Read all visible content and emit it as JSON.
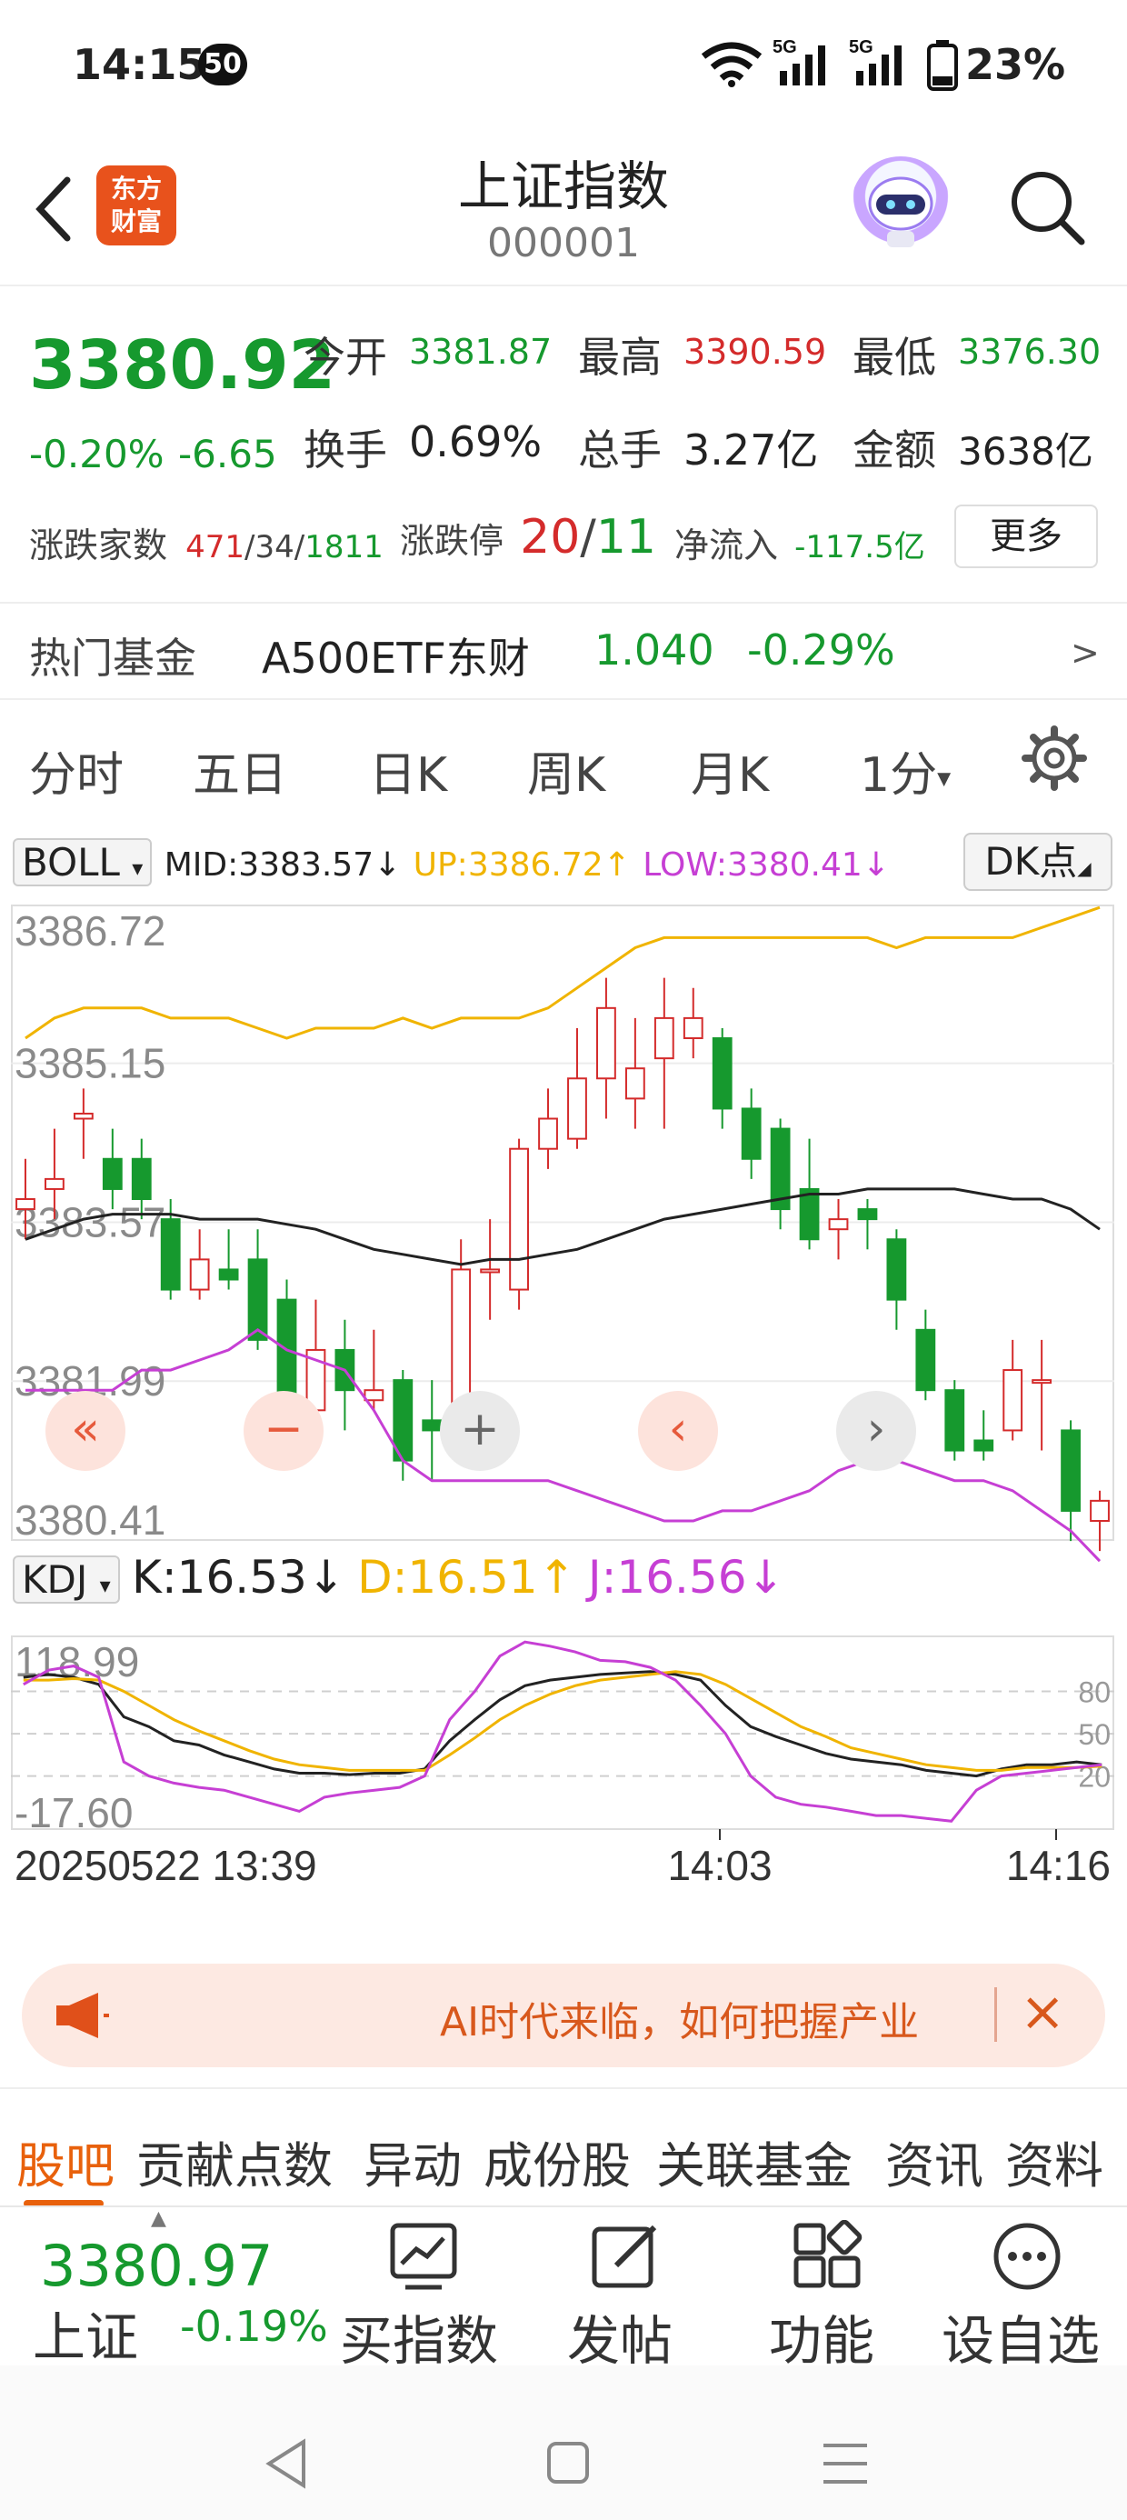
{
  "status_bar": {
    "time": "14:15",
    "badge": "50",
    "network1": "5G",
    "network2": "5G",
    "battery": "23%"
  },
  "header": {
    "title": "上证指数",
    "code": "000001",
    "logo_line1": "东方",
    "logo_line2": "财富"
  },
  "quote": {
    "price": "3380.92",
    "change_pct": "-0.20%",
    "change_abs": "-6.65",
    "open_label": "今开",
    "open": "3381.87",
    "high_label": "最高",
    "high": "3390.59",
    "low_label": "最低",
    "low": "3376.30",
    "turnover_label": "换手",
    "turnover": "0.69%",
    "volume_label": "总手",
    "volume": "3.27亿",
    "amount_label": "金额",
    "amount": "3638亿",
    "breadth_label": "涨跌家数",
    "breadth_up": "471",
    "breadth_flat": "34",
    "breadth_down": "1811",
    "limit_label": "涨跌停",
    "limit_up": "20",
    "limit_down": "11",
    "netflow_label": "净流入",
    "netflow": "-117.5亿",
    "more_label": "更多",
    "sep": "/"
  },
  "hot_fund": {
    "label": "热门基金",
    "name": "A500ETF东财",
    "price": "1.040",
    "change": "-0.29%",
    "arrow": ">"
  },
  "tabs": {
    "items": [
      "分时",
      "五日",
      "日K",
      "周K",
      "月K"
    ],
    "active": "1分",
    "active_arrow": "▾"
  },
  "indicator_boll": {
    "name": "BOLL",
    "mid": "MID:3383.57↓",
    "up": "UP:3386.72↑",
    "low": "LOW:3380.41↓",
    "dk_label": "DK点"
  },
  "indicator_kdj": {
    "name": "KDJ",
    "k": "K:16.53↓",
    "d": "D:16.51↑",
    "j": "J:16.56↓"
  },
  "chart_data": [
    {
      "type": "candlestick",
      "indicator": "BOLL",
      "ylim": [
        3380.41,
        3386.72
      ],
      "y_ticks": [
        "3386.72",
        "3385.15",
        "3383.57",
        "3381.99",
        "3380.41"
      ],
      "x_labels": [
        "20250522 13:39",
        "14:03",
        "14:16"
      ],
      "colors": {
        "up": "#d42b2b",
        "down": "#16992e",
        "mid": "#222222",
        "upper": "#f0b400",
        "lower": "#c63fd4"
      },
      "candles": [
        {
          "o": 3383.7,
          "c": 3383.8,
          "h": 3384.2,
          "l": 3383.4
        },
        {
          "o": 3383.9,
          "c": 3384.0,
          "h": 3384.5,
          "l": 3383.6
        },
        {
          "o": 3384.6,
          "c": 3384.65,
          "h": 3384.9,
          "l": 3384.2
        },
        {
          "o": 3384.2,
          "c": 3383.9,
          "h": 3384.5,
          "l": 3383.7
        },
        {
          "o": 3384.2,
          "c": 3383.8,
          "h": 3384.4,
          "l": 3383.6
        },
        {
          "o": 3383.6,
          "c": 3382.9,
          "h": 3383.8,
          "l": 3382.8
        },
        {
          "o": 3382.9,
          "c": 3383.2,
          "h": 3383.5,
          "l": 3382.8
        },
        {
          "o": 3383.1,
          "c": 3383.0,
          "h": 3383.5,
          "l": 3382.9
        },
        {
          "o": 3383.2,
          "c": 3382.4,
          "h": 3383.5,
          "l": 3382.3
        },
        {
          "o": 3382.8,
          "c": 3381.7,
          "h": 3383.0,
          "l": 3381.5
        },
        {
          "o": 3381.7,
          "c": 3382.3,
          "h": 3382.8,
          "l": 3381.6
        },
        {
          "o": 3382.3,
          "c": 3381.9,
          "h": 3382.6,
          "l": 3381.5
        },
        {
          "o": 3381.8,
          "c": 3381.9,
          "h": 3382.5,
          "l": 3381.7
        },
        {
          "o": 3382.0,
          "c": 3381.2,
          "h": 3382.1,
          "l": 3381.0
        },
        {
          "o": 3381.6,
          "c": 3381.5,
          "h": 3382.0,
          "l": 3381.0
        },
        {
          "o": 3381.6,
          "c": 3383.1,
          "h": 3383.4,
          "l": 3381.5
        },
        {
          "o": 3383.1,
          "c": 3383.1,
          "h": 3383.6,
          "l": 3382.6
        },
        {
          "o": 3382.9,
          "c": 3384.3,
          "h": 3384.4,
          "l": 3382.7
        },
        {
          "o": 3384.3,
          "c": 3384.6,
          "h": 3384.9,
          "l": 3384.1
        },
        {
          "o": 3384.4,
          "c": 3385.0,
          "h": 3385.5,
          "l": 3384.3
        },
        {
          "o": 3385.0,
          "c": 3385.7,
          "h": 3386.0,
          "l": 3384.6
        },
        {
          "o": 3384.8,
          "c": 3385.1,
          "h": 3385.6,
          "l": 3384.5
        },
        {
          "o": 3385.2,
          "c": 3385.6,
          "h": 3386.0,
          "l": 3384.5
        },
        {
          "o": 3385.4,
          "c": 3385.6,
          "h": 3385.9,
          "l": 3385.2
        },
        {
          "o": 3385.4,
          "c": 3384.7,
          "h": 3385.5,
          "l": 3384.5
        },
        {
          "o": 3384.7,
          "c": 3384.2,
          "h": 3384.9,
          "l": 3384.0
        },
        {
          "o": 3384.5,
          "c": 3383.7,
          "h": 3384.6,
          "l": 3383.5
        },
        {
          "o": 3383.9,
          "c": 3383.4,
          "h": 3384.4,
          "l": 3383.3
        },
        {
          "o": 3383.5,
          "c": 3383.6,
          "h": 3383.8,
          "l": 3383.2
        },
        {
          "o": 3383.7,
          "c": 3383.6,
          "h": 3383.8,
          "l": 3383.3
        },
        {
          "o": 3383.4,
          "c": 3382.8,
          "h": 3383.5,
          "l": 3382.5
        },
        {
          "o": 3382.5,
          "c": 3381.9,
          "h": 3382.7,
          "l": 3381.8
        },
        {
          "o": 3381.9,
          "c": 3381.3,
          "h": 3382.0,
          "l": 3381.2
        },
        {
          "o": 3381.4,
          "c": 3381.3,
          "h": 3381.7,
          "l": 3381.2
        },
        {
          "o": 3381.5,
          "c": 3382.1,
          "h": 3382.4,
          "l": 3381.4
        },
        {
          "o": 3382.0,
          "c": 3382.0,
          "h": 3382.4,
          "l": 3381.3
        },
        {
          "o": 3381.5,
          "c": 3380.7,
          "h": 3381.6,
          "l": 3380.4
        },
        {
          "o": 3380.6,
          "c": 3380.8,
          "h": 3380.9,
          "l": 3380.3
        }
      ],
      "boll_upper": [
        3385.4,
        3385.6,
        3385.7,
        3385.7,
        3385.7,
        3385.6,
        3385.6,
        3385.6,
        3385.5,
        3385.4,
        3385.5,
        3385.5,
        3385.5,
        3385.6,
        3385.5,
        3385.6,
        3385.6,
        3385.6,
        3385.7,
        3385.9,
        3386.1,
        3386.3,
        3386.4,
        3386.4,
        3386.4,
        3386.4,
        3386.4,
        3386.4,
        3386.4,
        3386.4,
        3386.3,
        3386.4,
        3386.4,
        3386.4,
        3386.4,
        3386.5,
        3386.6,
        3386.7
      ],
      "boll_mid": [
        3383.4,
        3383.5,
        3383.6,
        3383.65,
        3383.65,
        3383.65,
        3383.6,
        3383.6,
        3383.6,
        3383.55,
        3383.5,
        3383.4,
        3383.3,
        3383.25,
        3383.2,
        3383.15,
        3383.2,
        3383.2,
        3383.25,
        3383.3,
        3383.4,
        3383.5,
        3383.6,
        3383.65,
        3383.7,
        3383.75,
        3383.8,
        3383.85,
        3383.85,
        3383.9,
        3383.9,
        3383.9,
        3383.9,
        3383.85,
        3383.8,
        3383.8,
        3383.7,
        3383.5
      ],
      "boll_lower": [
        3381.9,
        3381.9,
        3381.9,
        3381.9,
        3382.1,
        3382.1,
        3382.2,
        3382.3,
        3382.5,
        3382.3,
        3382.2,
        3382.1,
        3381.7,
        3381.2,
        3381.0,
        3381.0,
        3381.0,
        3381.0,
        3381.0,
        3380.9,
        3380.8,
        3380.7,
        3380.6,
        3380.6,
        3380.7,
        3380.7,
        3380.8,
        3380.9,
        3381.1,
        3381.2,
        3381.2,
        3381.1,
        3381.0,
        3381.0,
        3380.9,
        3380.7,
        3380.5,
        3380.2
      ]
    },
    {
      "type": "line",
      "indicator": "KDJ",
      "ylim": [
        -17.6,
        118.99
      ],
      "y_ticks_left": [
        "118.99",
        "-17.60"
      ],
      "y_ticks_right": [
        "80",
        "50",
        "20"
      ],
      "series": [
        {
          "name": "K",
          "color": "#222222",
          "values": [
            90,
            92,
            90,
            85,
            62,
            55,
            45,
            42,
            35,
            30,
            25,
            22,
            22,
            21,
            22,
            22,
            25,
            45,
            60,
            74,
            84,
            88,
            90,
            92,
            93,
            94,
            92,
            88,
            70,
            55,
            48,
            42,
            36,
            32,
            30,
            28,
            24,
            22,
            20,
            25,
            28,
            28,
            30,
            28
          ]
        },
        {
          "name": "D",
          "color": "#f0b400",
          "values": [
            88,
            88,
            89,
            88,
            80,
            70,
            60,
            52,
            45,
            38,
            32,
            28,
            26,
            24,
            24,
            24,
            24,
            35,
            47,
            60,
            70,
            78,
            84,
            88,
            90,
            92,
            94,
            92,
            85,
            75,
            65,
            55,
            48,
            40,
            36,
            32,
            28,
            26,
            24,
            24,
            26,
            26,
            26,
            27
          ]
        },
        {
          "name": "J",
          "color": "#c63fd4",
          "values": [
            85,
            95,
            98,
            90,
            30,
            20,
            15,
            12,
            10,
            5,
            0,
            -5,
            5,
            8,
            10,
            12,
            20,
            60,
            80,
            105,
            115,
            112,
            108,
            102,
            101,
            97,
            88,
            70,
            50,
            20,
            5,
            0,
            -2,
            -5,
            -8,
            -8,
            -10,
            -12,
            10,
            20,
            22,
            24,
            26,
            28
          ]
        }
      ]
    }
  ],
  "chart_controls": [
    "«",
    "−",
    "+",
    "‹",
    "›"
  ],
  "banner": {
    "text": "AI时代来临，如何把握产业",
    "close": "×"
  },
  "sub_tabs": [
    "股吧",
    "贡献点数",
    "异动",
    "成份股",
    "关联基金",
    "资讯",
    "资料"
  ],
  "toolbar": {
    "price": "3380.97",
    "name": "上证",
    "pct": "-0.19%",
    "buy_label": "买指数",
    "post_label": "发帖",
    "func_label": "功能",
    "fav_label": "设自选"
  }
}
